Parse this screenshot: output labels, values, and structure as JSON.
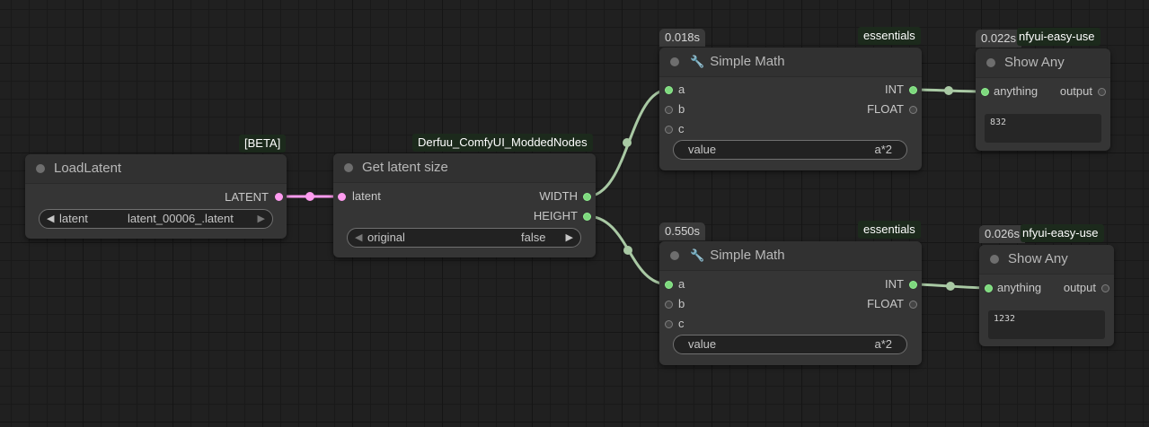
{
  "nodes": {
    "load_latent": {
      "title": "LoadLatent",
      "badge": "[BETA]",
      "output_latent": "LATENT",
      "widget_label": "latent",
      "widget_value": "latent_00006_.latent"
    },
    "get_latent_size": {
      "title": "Get latent size",
      "badge": "Derfuu_ComfyUI_ModdedNodes",
      "input_latent": "latent",
      "output_width": "WIDTH",
      "output_height": "HEIGHT",
      "widget_label": "original",
      "widget_value": "false"
    },
    "simple_math_top": {
      "title": "Simple Math",
      "time": "0.018s",
      "badge": "essentials",
      "input_a": "a",
      "input_b": "b",
      "input_c": "c",
      "output_int": "INT",
      "output_float": "FLOAT",
      "widget_label": "value",
      "widget_value": "a*2"
    },
    "simple_math_bottom": {
      "title": "Simple Math",
      "time": "0.550s",
      "badge": "essentials",
      "input_a": "a",
      "input_b": "b",
      "input_c": "c",
      "output_int": "INT",
      "output_float": "FLOAT",
      "widget_label": "value",
      "widget_value": "a*2"
    },
    "show_any_top": {
      "title": "Show Any",
      "time": "0.022s",
      "badge": "nfyui-easy-use",
      "input_anything": "anything",
      "output_output": "output",
      "display_value": "832"
    },
    "show_any_bottom": {
      "title": "Show Any",
      "time": "0.026s",
      "badge": "nfyui-easy-use",
      "input_anything": "anything",
      "output_output": "output",
      "display_value": "1232"
    }
  },
  "colors": {
    "latent_link": "#ff9cf0",
    "int_link": "#a9c9a4",
    "canvas": "#202020",
    "node_body": "#353535",
    "badge_bg": "#1c2a1c"
  },
  "icons": {
    "simple_math": "wrench-icon"
  }
}
